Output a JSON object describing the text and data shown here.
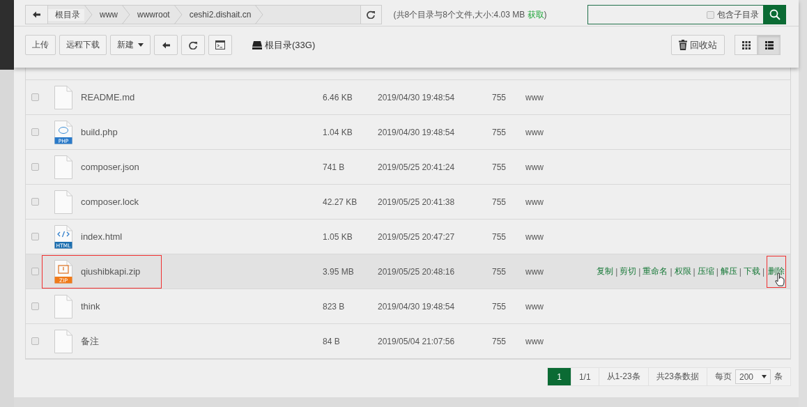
{
  "breadcrumb": {
    "items": [
      "根目录",
      "www",
      "wwwroot",
      "ceshi2.dishait.cn"
    ]
  },
  "summary": {
    "text": "(共8个目录与8个文件,大小:4.03 MB",
    "link": "获取",
    "tail": ")"
  },
  "search": {
    "option": "包含子目录",
    "checked": false
  },
  "toolbar": {
    "buttons": [
      {
        "label": "上传",
        "kind": "text"
      },
      {
        "label": "远程下载",
        "kind": "text"
      },
      {
        "label": "新建",
        "kind": "dropdown"
      },
      {
        "kind": "back"
      },
      {
        "kind": "refresh"
      },
      {
        "kind": "terminal"
      }
    ],
    "disk": "根目录(33G)",
    "recycle": "回收站",
    "views": [
      {
        "kind": "grid",
        "selected": false
      },
      {
        "kind": "list",
        "selected": true
      }
    ]
  },
  "rows": [
    {
      "name": "README.md",
      "kind": "blank",
      "size": "6.46 KB",
      "time": "2019/04/30 19:48:54",
      "perm": "755",
      "owner": "www",
      "checked": false,
      "hovered": false,
      "outlined": false
    },
    {
      "name": "build.php",
      "kind": "php",
      "icon_label": "PHP",
      "size": "1.04 KB",
      "time": "2019/04/30 19:48:54",
      "perm": "755",
      "owner": "www",
      "checked": false,
      "hovered": false,
      "outlined": false
    },
    {
      "name": "composer.json",
      "kind": "blank",
      "size": "741 B",
      "time": "2019/05/25 20:41:24",
      "perm": "755",
      "owner": "www",
      "checked": false,
      "hovered": false,
      "outlined": false
    },
    {
      "name": "composer.lock",
      "kind": "blank",
      "size": "42.27 KB",
      "time": "2019/05/25 20:41:38",
      "perm": "755",
      "owner": "www",
      "checked": false,
      "hovered": false,
      "outlined": false
    },
    {
      "name": "index.html",
      "kind": "html",
      "icon_label": "HTML",
      "size": "1.05 KB",
      "time": "2019/05/25 20:47:27",
      "perm": "755",
      "owner": "www",
      "checked": false,
      "hovered": false,
      "outlined": false
    },
    {
      "name": "qiushibkapi.zip",
      "kind": "zip",
      "icon_label": "ZIP",
      "size": "3.95 MB",
      "time": "2019/05/25 20:48:16",
      "perm": "755",
      "owner": "www",
      "checked": false,
      "hovered": true,
      "outlined": true,
      "separator": "|",
      "actions": [
        {
          "label": "复制",
          "outlined": false
        },
        {
          "label": "剪切",
          "outlined": false
        },
        {
          "label": "重命名",
          "outlined": false
        },
        {
          "label": "权限",
          "outlined": false
        },
        {
          "label": "压缩",
          "outlined": false
        },
        {
          "label": "解压",
          "outlined": false
        },
        {
          "label": "下载",
          "outlined": false
        },
        {
          "label": "删除",
          "outlined": true
        }
      ]
    },
    {
      "name": "think",
      "kind": "blank",
      "size": "823 B",
      "time": "2019/04/30 19:48:54",
      "perm": "755",
      "owner": "www",
      "checked": false,
      "hovered": false,
      "outlined": false
    },
    {
      "name": "备注",
      "kind": "blank",
      "size": "84 B",
      "time": "2019/05/04 21:07:56",
      "perm": "755",
      "owner": "www",
      "checked": false,
      "hovered": false,
      "outlined": false
    }
  ],
  "pagination": {
    "pages": [
      {
        "label": "1",
        "selected": true
      }
    ],
    "page_count": "1/1",
    "range": "从1-23条",
    "total": "共23条数据",
    "per_page": "每页",
    "per_page_value": "200",
    "unit": "条"
  }
}
